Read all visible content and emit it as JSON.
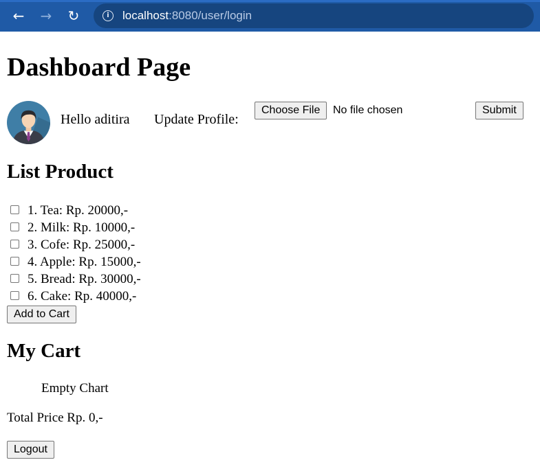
{
  "browser": {
    "url_host": "localhost",
    "url_rest": ":8080/user/login"
  },
  "page": {
    "title": "Dashboard Page",
    "greeting": "Hello aditira",
    "update_profile_label": "Update Profile:",
    "choose_file_label": "Choose File",
    "file_status": "No file chosen",
    "submit_label": "Submit"
  },
  "products": {
    "heading": "List Product",
    "items": [
      "1. Tea: Rp. 20000,-",
      "2. Milk: Rp. 10000,-",
      "3. Cofe: Rp. 25000,-",
      "4. Apple: Rp. 15000,-",
      "5. Bread: Rp. 30000,-",
      "6. Cake: Rp. 40000,-"
    ],
    "add_to_cart_label": "Add to Cart"
  },
  "cart": {
    "heading": "My Cart",
    "empty_text": "Empty Chart",
    "total_text": "Total Price Rp. 0,-"
  },
  "logout_label": "Logout",
  "colors": {
    "browser_bar": "#1f5aa6",
    "omnibox": "#16457f"
  }
}
